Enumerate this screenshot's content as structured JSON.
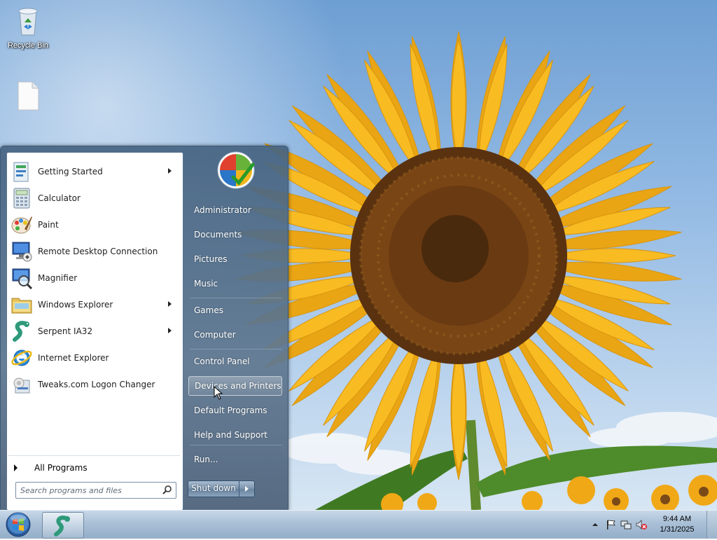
{
  "desktop": {
    "icons": [
      {
        "label": "Recycle Bin",
        "icon": "recycle-bin-icon"
      },
      {
        "label": "",
        "icon": "blank-file-icon"
      }
    ]
  },
  "start_menu": {
    "programs": [
      {
        "label": "Getting Started",
        "icon": "getting-started-icon",
        "submenu": true
      },
      {
        "label": "Calculator",
        "icon": "calculator-icon",
        "submenu": false
      },
      {
        "label": "Paint",
        "icon": "paint-icon",
        "submenu": false
      },
      {
        "label": "Remote Desktop Connection",
        "icon": "remote-desktop-icon",
        "submenu": false
      },
      {
        "label": "Magnifier",
        "icon": "magnifier-icon",
        "submenu": false
      },
      {
        "label": "Windows Explorer",
        "icon": "folder-icon",
        "submenu": true
      },
      {
        "label": "Serpent IA32",
        "icon": "serpent-icon",
        "submenu": true
      },
      {
        "label": "Internet Explorer",
        "icon": "internet-explorer-icon",
        "submenu": false
      },
      {
        "label": "Tweaks.com Logon Changer",
        "icon": "logon-changer-icon",
        "submenu": false
      }
    ],
    "all_programs": "All Programs",
    "search_placeholder": "Search programs and files",
    "right_items": [
      {
        "label": "Administrator"
      },
      {
        "label": "Documents"
      },
      {
        "label": "Pictures"
      },
      {
        "label": "Music"
      },
      {
        "label": "Games"
      },
      {
        "label": "Computer"
      },
      {
        "label": "Control Panel"
      },
      {
        "label": "Devices and Printers",
        "highlighted": true
      },
      {
        "label": "Default Programs"
      },
      {
        "label": "Help and Support"
      },
      {
        "label": "Run..."
      }
    ],
    "shutdown_label": "Shut down"
  },
  "taskbar": {
    "clock_time": "9:44 AM",
    "clock_date": "1/31/2025",
    "pinned": [
      "serpent-icon"
    ],
    "tray_icons": [
      "show-hidden-icons-arrow-icon",
      "action-center-flag-icon",
      "network-icon",
      "volume-muted-icon"
    ]
  },
  "colors": {
    "menu_glass": "#5e7896",
    "taskbar": "#a9c0d7",
    "sunflower_petal": "#f5b31c",
    "sunflower_center": "#6b3a12"
  }
}
